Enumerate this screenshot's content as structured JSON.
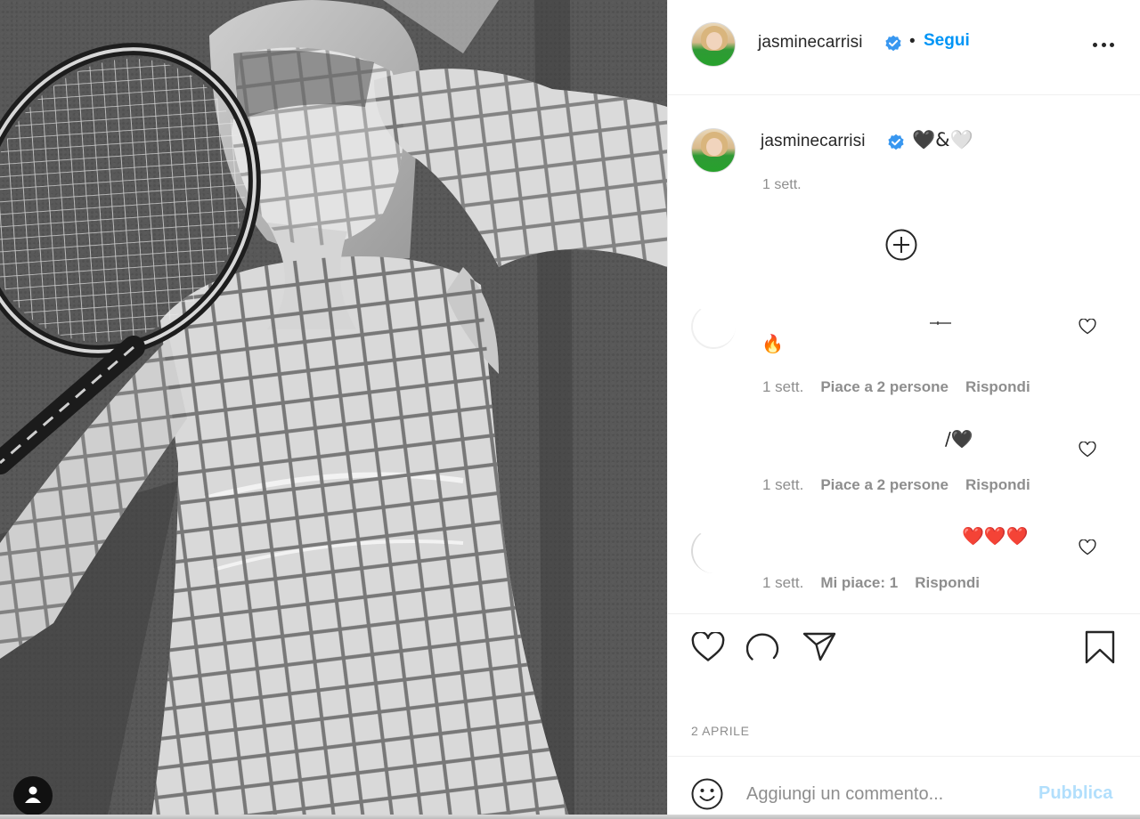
{
  "post": {
    "username": "jasminecarrisi",
    "follow_label": "Segui",
    "separator": "•",
    "caption": "🖤&🤍",
    "caption_time": "1 sett.",
    "date": "2 APRILE"
  },
  "comments": [
    {
      "text": "🔥",
      "time": "1 sett.",
      "likes": "Piace a 2 persone",
      "reply": "Rispondi"
    },
    {
      "text": "/🖤",
      "time": "1 sett.",
      "likes": "Piace a 2 persone",
      "reply": "Rispondi"
    },
    {
      "text": "❤️❤️❤️",
      "time": "1 sett.",
      "likes": "Mi piace: 1",
      "reply": "Rispondi"
    }
  ],
  "composer": {
    "placeholder": "Aggiungi un commento...",
    "publish_label": "Pubblica"
  },
  "colors": {
    "accent": "#0095f6",
    "publish_disabled": "#b2dffc",
    "secondary_text": "#8e8e8e",
    "primary_text": "#262626",
    "verified_badge": "#3897f0"
  },
  "icons": {
    "verified": "verified-badge-icon",
    "more": "more-options-icon",
    "load_more": "plus-circle-icon",
    "comment_like": "heart-icon",
    "like": "heart-icon",
    "comment": "comment-bubble-icon",
    "share": "paper-plane-icon",
    "save": "bookmark-icon",
    "emoji": "smiley-icon",
    "user_tag": "user-tag-icon"
  }
}
